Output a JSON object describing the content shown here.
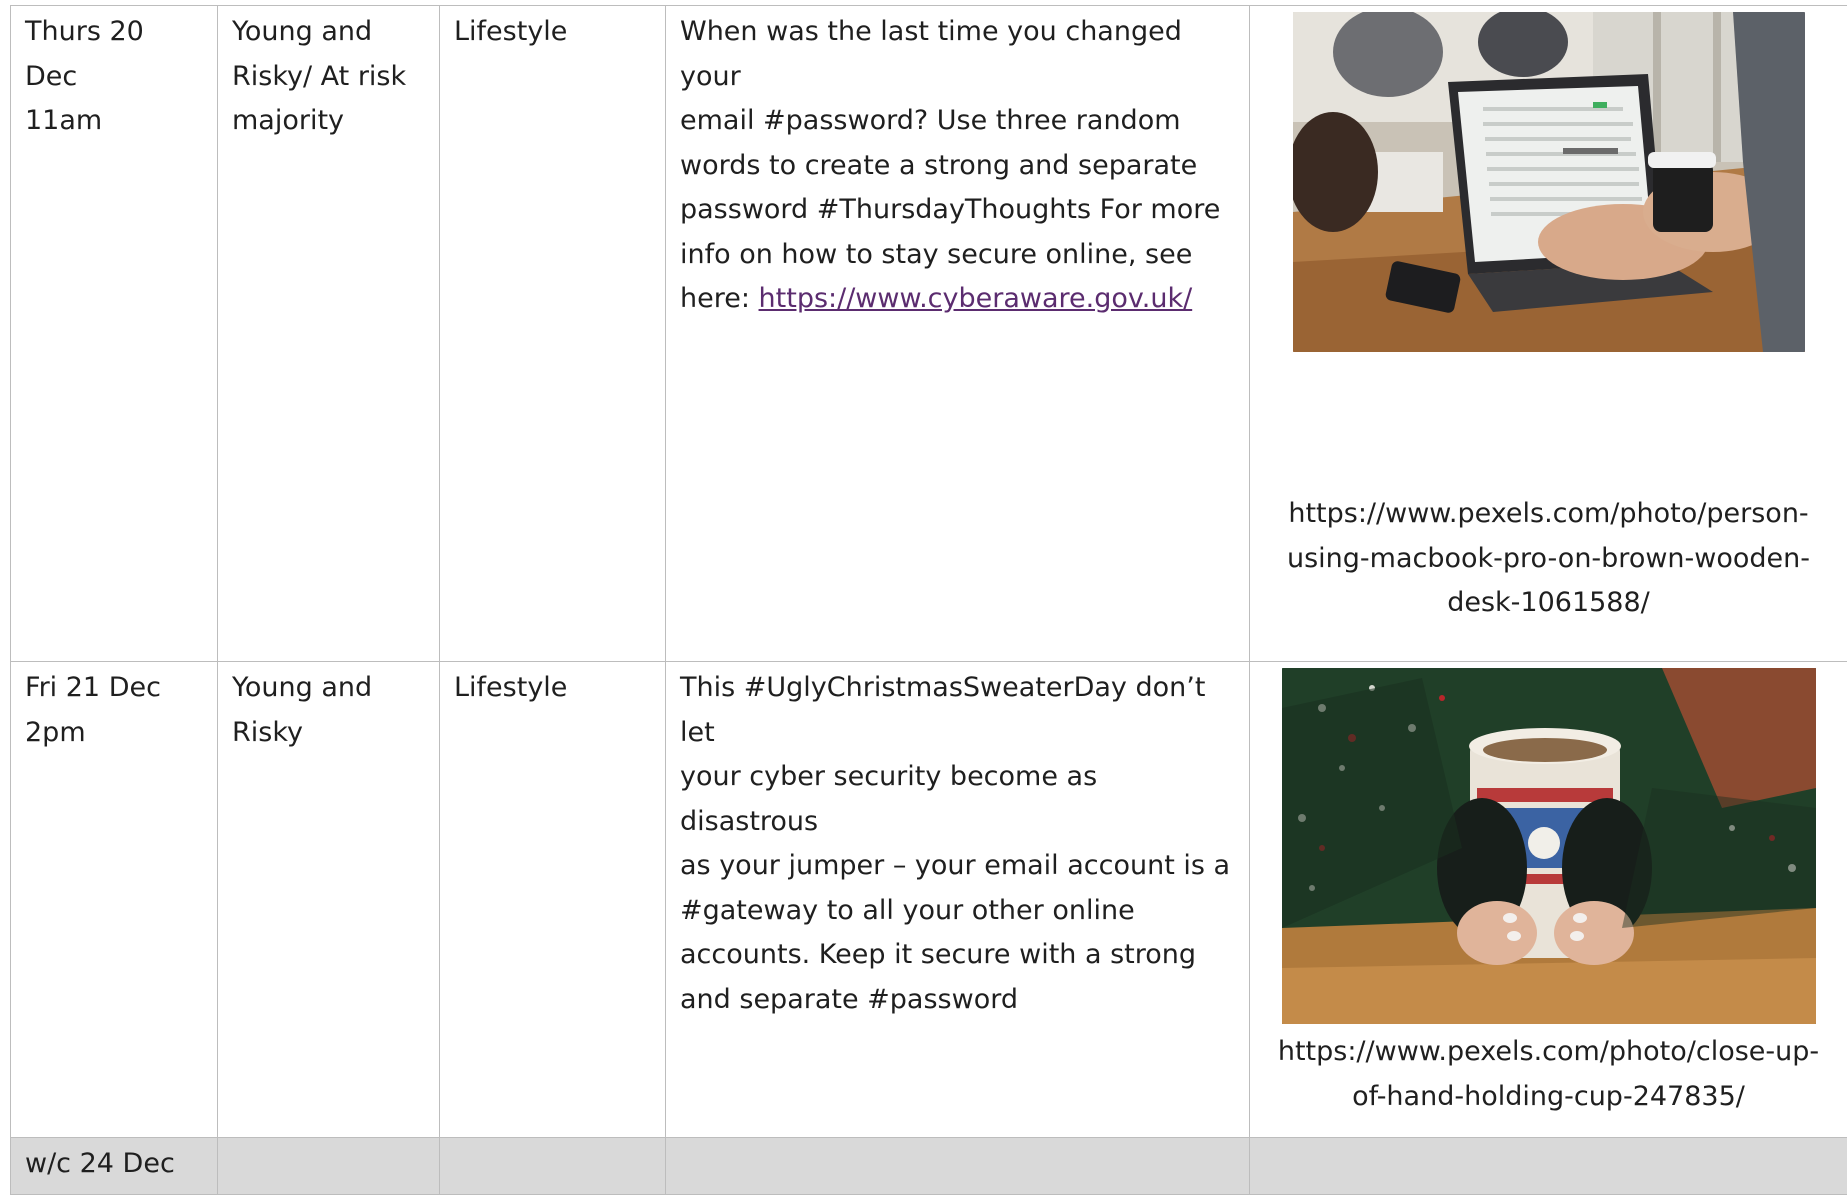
{
  "rows": [
    {
      "date": [
        "Thurs 20 Dec",
        "11am"
      ],
      "audience": [
        "Young and",
        "Risky/ At risk",
        "majority"
      ],
      "theme": "Lifestyle",
      "copy_lines": [
        "When was the last time you changed your",
        "email #password? Use three random",
        "words to create a strong and separate",
        "password #ThursdayThoughts For more",
        "info on how to stay secure online, see"
      ],
      "copy_last_prefix": "here: ",
      "copy_link": "https://www.cyberaware.gov.uk/",
      "image_name": "person-typing-laptop",
      "caption": [
        "https://www.pexels.com/photo/person-",
        "using-macbook-pro-on-brown-wooden-",
        "desk-1061588/"
      ]
    },
    {
      "date": [
        "Fri 21 Dec",
        "2pm"
      ],
      "audience": [
        "Young and",
        "Risky"
      ],
      "theme": "Lifestyle",
      "copy_lines": [
        "This #UglyChristmasSweaterDay don’t let",
        "your cyber security become as disastrous",
        "as your jumper – your email account is a",
        "#gateway to all your other online",
        "accounts. Keep it secure with a strong",
        "and separate #password"
      ],
      "image_name": "hands-holding-cup",
      "caption": [
        "https://www.pexels.com/photo/close-up-",
        "of-hand-holding-cup-247835/"
      ]
    },
    {
      "date": [
        "w/c 24 Dec"
      ]
    }
  ],
  "colors": {
    "border": "#bdbdbd",
    "week_row_bg": "#d9d9d9",
    "link": "#5b2c6f"
  }
}
